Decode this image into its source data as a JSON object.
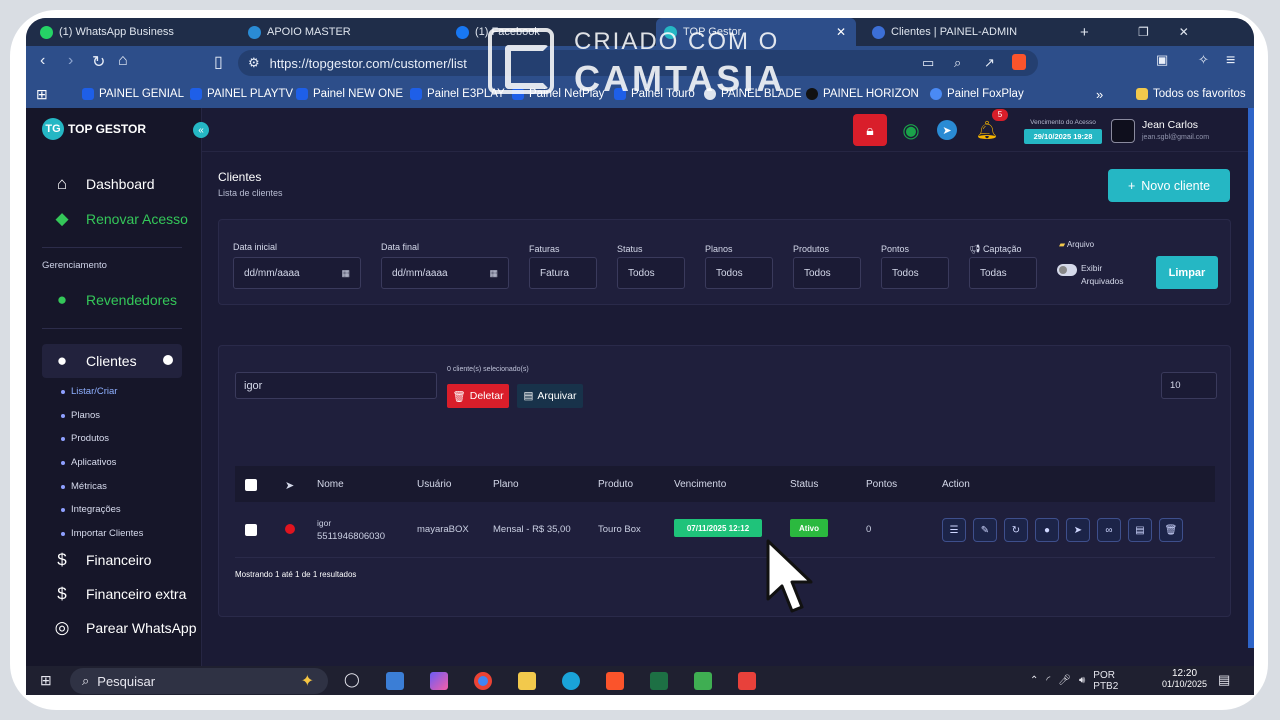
{
  "browser": {
    "tabs": [
      {
        "label": "(1) WhatsApp Business",
        "color": "#25d366"
      },
      {
        "label": "APOIO MASTER",
        "color": "#2a8bd4"
      },
      {
        "label": "(1) Facebook",
        "color": "#1877f2"
      },
      {
        "label": "TOP Gestor",
        "color": "#25b7c4"
      },
      {
        "label": "Clientes | PAINEL-ADMIN",
        "color": "#3c6fd6"
      }
    ],
    "new_tab": "+",
    "url": "https://topgestor.com/customer/list",
    "bookmarks": [
      "PAINEL GENIAL",
      "PAINEL PLAYTV",
      "Painel NEW ONE",
      "Painel E3PLAY",
      "Painel NetPlay",
      "Painel Touro",
      "PAINEL BLADE",
      "PAINEL HORIZON",
      "Painel FoxPlay"
    ],
    "bookmarks_more": "»",
    "all_favorites": "Todos os favoritos"
  },
  "watermark": {
    "line1": "CRIADO COM O",
    "line2": "CAMTASIA"
  },
  "sidebar": {
    "logo": "TOP GESTOR",
    "dashboard": "Dashboard",
    "renovar": "Renovar Acesso",
    "section": "Gerenciamento",
    "revendedores": "Revendedores",
    "clientes": "Clientes",
    "sub": [
      "Listar/Criar",
      "Planos",
      "Produtos",
      "Aplicativos",
      "Métricas",
      "Integrações",
      "Importar Clientes"
    ],
    "financeiro": "Financeiro",
    "financeiro_extra": "Financeiro extra",
    "parear": "Parear WhatsApp"
  },
  "header": {
    "notif_count": "5",
    "venc_label": "Vencimento do Acesso",
    "venc_date": "29/10/2025 19:28",
    "user_name": "Jean Carlos",
    "user_email": "jean.sgbl@gmail.com"
  },
  "page": {
    "title": "Clientes",
    "subtitle": "Lista de clientes",
    "new_button": "Novo cliente"
  },
  "filters": {
    "data_inicial": {
      "label": "Data inicial",
      "value": "dd/mm/aaaa"
    },
    "data_final": {
      "label": "Data final",
      "value": "dd/mm/aaaa"
    },
    "faturas": {
      "label": "Faturas",
      "value": "Fatura"
    },
    "status": {
      "label": "Status",
      "value": "Todos"
    },
    "planos": {
      "label": "Planos",
      "value": "Todos"
    },
    "produtos": {
      "label": "Produtos",
      "value": "Todos"
    },
    "pontos": {
      "label": "Pontos",
      "value": "Todos"
    },
    "captacao": {
      "label": "Captação",
      "value": "Todas"
    },
    "arquivo": "Arquivo",
    "exibir": "Exibir Arquivados",
    "limpar": "Limpar"
  },
  "table": {
    "search_value": "igor",
    "selected_text": "0 cliente(s) selecionado(s)",
    "delete_label": "Deletar",
    "archive_label": "Arquivar",
    "per_page": "10",
    "columns": [
      "Nome",
      "Usuário",
      "Plano",
      "Produto",
      "Vencimento",
      "Status",
      "Pontos",
      "Action"
    ],
    "rows": [
      {
        "nome": "igor",
        "telefone": "5511946806030",
        "usuario": "mayaraBOX",
        "plano": "Mensal - R$ 35,00",
        "produto": "Touro Box",
        "vencimento": "07/11/2025 12:12",
        "status": "Ativo",
        "pontos": "0"
      }
    ],
    "footer": "Mostrando 1 até 1 de 1 resultados"
  },
  "taskbar": {
    "search": "Pesquisar",
    "lang": "POR",
    "lang2": "PTB2",
    "time": "12:20",
    "date": "01/10/2025"
  }
}
